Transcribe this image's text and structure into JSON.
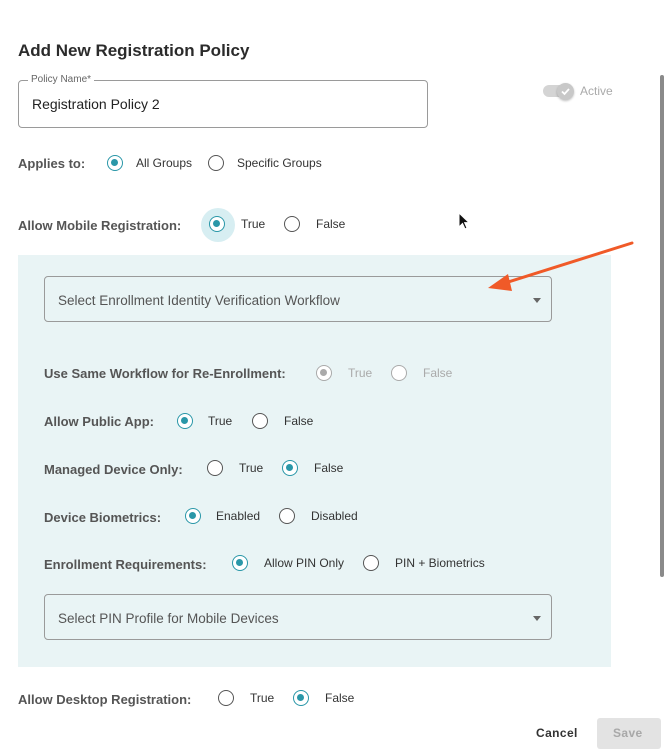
{
  "dialog": {
    "title": "Add New Registration Policy"
  },
  "policy_name": {
    "label": "Policy Name*",
    "value": "Registration Policy 2"
  },
  "active_toggle": {
    "label": "Active",
    "on": true
  },
  "applies_to": {
    "label": "Applies to:",
    "options": [
      {
        "label": "All Groups",
        "selected": true
      },
      {
        "label": "Specific Groups",
        "selected": false
      }
    ]
  },
  "allow_mobile": {
    "label": "Allow Mobile Registration:",
    "options": [
      {
        "label": "True",
        "selected": true
      },
      {
        "label": "False",
        "selected": false
      }
    ]
  },
  "mobile_panel": {
    "enrollment_workflow": {
      "placeholder": "Select Enrollment Identity Verification Workflow"
    },
    "same_workflow": {
      "label": "Use Same Workflow for Re-Enrollment:",
      "options": [
        {
          "label": "True",
          "selected": true
        },
        {
          "label": "False",
          "selected": false
        }
      ],
      "disabled": true
    },
    "public_app": {
      "label": "Allow Public App:",
      "options": [
        {
          "label": "True",
          "selected": true
        },
        {
          "label": "False",
          "selected": false
        }
      ]
    },
    "managed_device": {
      "label": "Managed Device Only:",
      "options": [
        {
          "label": "True",
          "selected": false
        },
        {
          "label": "False",
          "selected": true
        }
      ]
    },
    "device_biometrics": {
      "label": "Device Biometrics:",
      "options": [
        {
          "label": "Enabled",
          "selected": true
        },
        {
          "label": "Disabled",
          "selected": false
        }
      ]
    },
    "enrollment_requirements": {
      "label": "Enrollment Requirements:",
      "options": [
        {
          "label": "Allow PIN Only",
          "selected": true
        },
        {
          "label": "PIN + Biometrics",
          "selected": false
        }
      ]
    },
    "pin_profile": {
      "placeholder": "Select PIN Profile for Mobile Devices"
    }
  },
  "allow_desktop": {
    "label": "Allow Desktop Registration:",
    "options": [
      {
        "label": "True",
        "selected": false
      },
      {
        "label": "False",
        "selected": true
      }
    ]
  },
  "footer": {
    "cancel_label": "Cancel",
    "save_label": "Save"
  },
  "colors": {
    "accent": "#2a97a8",
    "panel_bg": "#e9f4f5",
    "annotation_arrow": "#f05a28"
  }
}
